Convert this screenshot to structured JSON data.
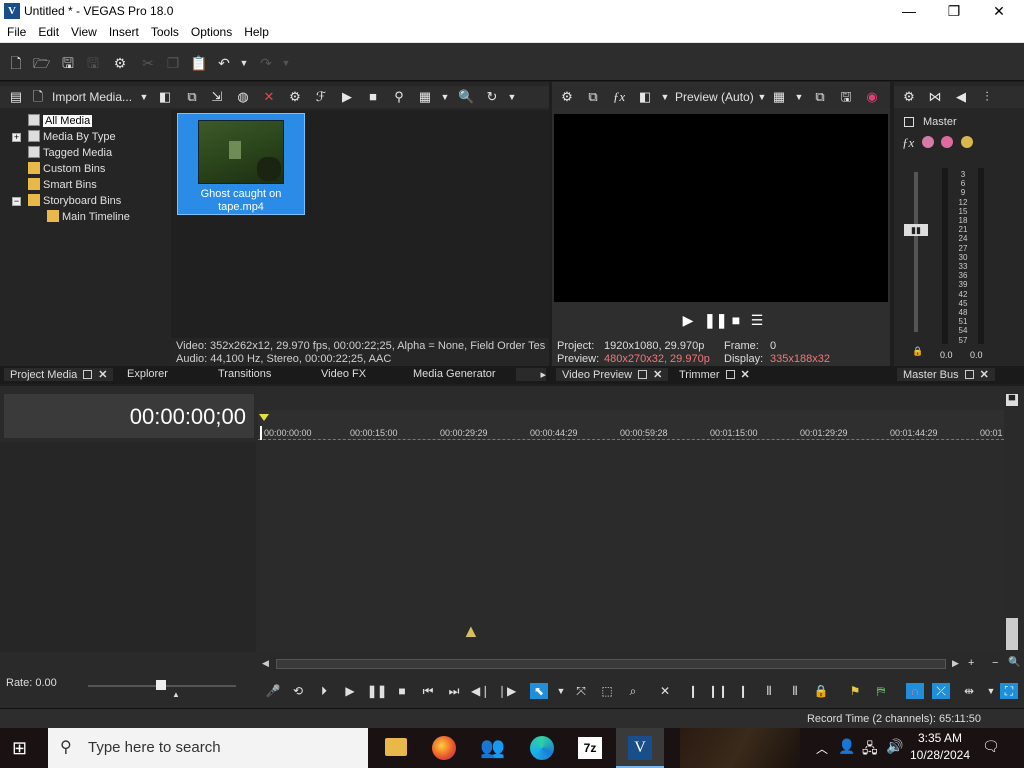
{
  "window": {
    "app_icon": "V",
    "title": "Untitled * - VEGAS Pro 18.0",
    "minimize": "—",
    "maximize": "❐",
    "close": "✕"
  },
  "menu": [
    "File",
    "Edit",
    "View",
    "Insert",
    "Tools",
    "Options",
    "Help"
  ],
  "project_media": {
    "import_label": "Import Media...",
    "tree": [
      {
        "label": "All Media"
      },
      {
        "label": "Media By Type"
      },
      {
        "label": "Tagged Media"
      },
      {
        "label": "Custom Bins"
      },
      {
        "label": "Smart Bins"
      },
      {
        "label": "Storyboard Bins"
      },
      {
        "label": "Main Timeline"
      }
    ],
    "clip_name": "Ghost caught on tape.mp4",
    "info_video": "Video: 352x262x12, 29.970 fps, 00:00:22;25, Alpha = None, Field Order Tes",
    "info_audio": "Audio: 44,100 Hz, Stereo, 00:00:22;25, AAC"
  },
  "preview": {
    "mode_label": "Preview (Auto)",
    "project_label": "Project:",
    "project_value": "1920x1080, 29.970p",
    "preview_label": "Preview:",
    "preview_value": "480x270x32, 29.970p",
    "frame_label": "Frame:",
    "frame_value": "0",
    "display_label": "Display:",
    "display_value": "335x188x32"
  },
  "master": {
    "label": "Master",
    "scale": [
      "3",
      "6",
      "9",
      "12",
      "15",
      "18",
      "21",
      "24",
      "27",
      "30",
      "33",
      "36",
      "39",
      "42",
      "45",
      "48",
      "51",
      "54",
      "57"
    ],
    "left_value": "0.0",
    "right_value": "0.0"
  },
  "tabs": {
    "project_media": "Project Media",
    "explorer": "Explorer",
    "transitions": "Transitions",
    "video_fx": "Video FX",
    "media_generator": "Media Generator",
    "video_preview": "Video Preview",
    "trimmer": "Trimmer",
    "master_bus": "Master Bus"
  },
  "timeline": {
    "timecode": "00:00:00;00",
    "ruler": [
      "00:00:00:00",
      "00:00:15:00",
      "00:00:29:29",
      "00:00:44:29",
      "00:00:59:28",
      "00:01:15:00",
      "00:01:29:29",
      "00:01:44:29",
      "00:01"
    ],
    "rate_label": "Rate: 0.00"
  },
  "status": {
    "record_time": "Record Time (2 channels): 65:11:50"
  },
  "taskbar": {
    "search_placeholder": "Type here to search",
    "time": "3:35 AM",
    "date": "10/28/2024",
    "apps": [
      "file-explorer",
      "firefox",
      "people",
      "edge",
      "7zip",
      "vegas"
    ],
    "seven_zip": "7z",
    "vegas": "V"
  },
  "colors": {
    "accent": "#1e8fd8",
    "selection": "#2a8ce6",
    "preview_value": "#f07878"
  }
}
